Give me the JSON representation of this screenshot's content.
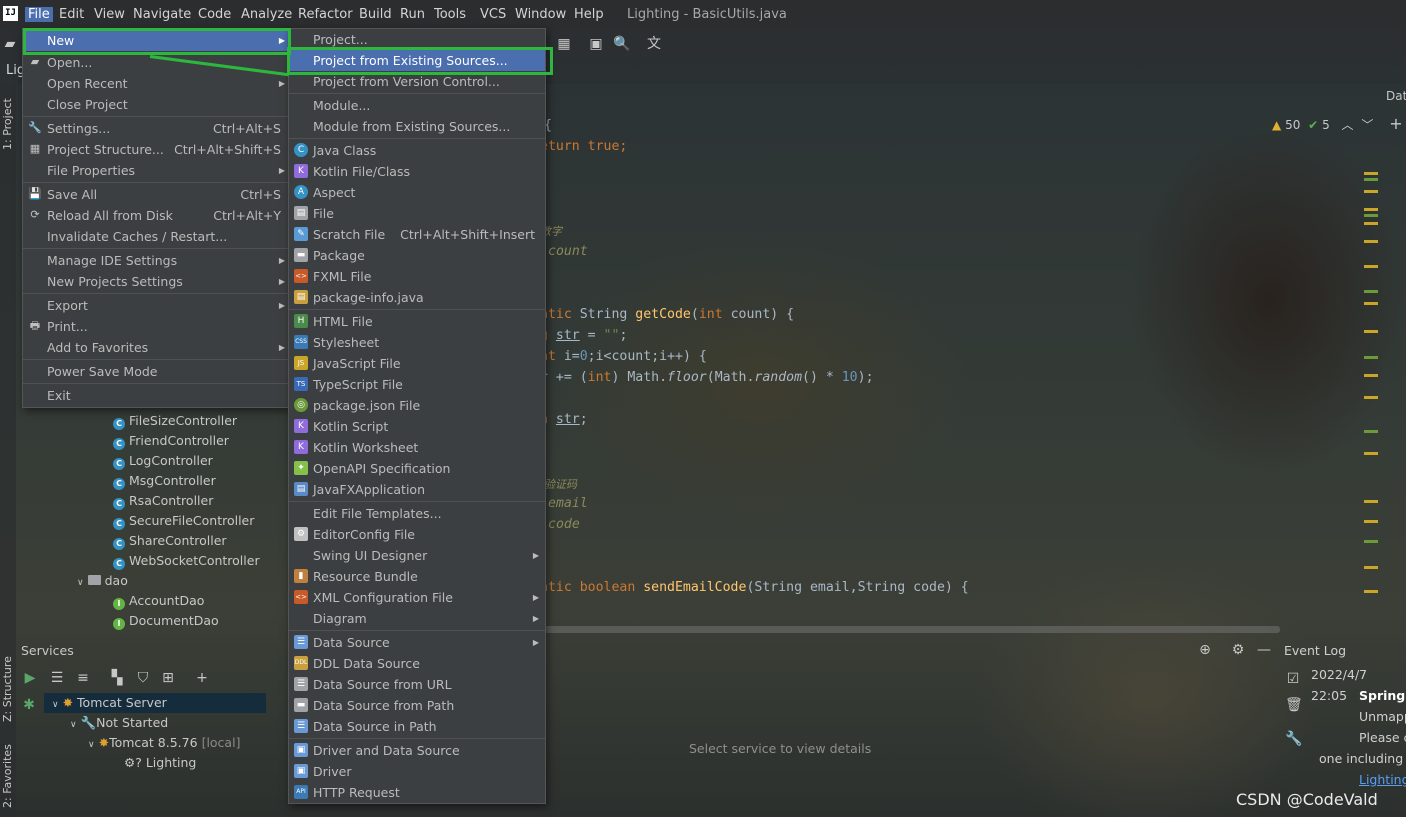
{
  "menubar": {
    "logo": "IJ",
    "items": [
      "File",
      "Edit",
      "View",
      "Navigate",
      "Code",
      "Analyze",
      "Refactor",
      "Build",
      "Run",
      "Tools",
      "VCS",
      "Window",
      "Help"
    ],
    "title": "Lighting - BasicUtils.java"
  },
  "panel": {
    "project_label": "Lig",
    "data_label": "Dat",
    "project_strip": "1: Project",
    "structure_strip": "Z: Structure",
    "favorites_strip": "2: Favorites"
  },
  "inspection": {
    "warnings": "50",
    "ok": "5"
  },
  "editor_lines": [
    {
      "text": "{"
    },
    {
      "text": "eturn true;"
    },
    {
      "text": "数字"
    },
    {
      "text": "count"
    },
    {
      "text": "atic String getCode(int count) {"
    },
    {
      "text": "g str = \"\";"
    },
    {
      "text": "nt i=0;i<count;i++) {"
    },
    {
      "text": "r += (int) Math.floor(Math.random() * 10);"
    },
    {
      "text": "n str;"
    },
    {
      "text": "验证码"
    },
    {
      "text": "email"
    },
    {
      "text": "code"
    },
    {
      "text": "atic boolean sendEmailCode(String email,String code) {"
    }
  ],
  "project_tree": {
    "controllers": [
      "FileSizeController",
      "FriendController",
      "LogController",
      "MsgController",
      "RsaController",
      "SecureFileController",
      "ShareController",
      "WebSocketController"
    ],
    "dao_folder": "dao",
    "dao_items": [
      "AccountDao",
      "DocumentDao"
    ]
  },
  "services": {
    "title": "Services",
    "nodes": [
      "Tomcat Server",
      "Not Started",
      "Tomcat 8.5.76",
      "[local]",
      "Lighting"
    ],
    "empty_text": "Select service to view details"
  },
  "event_log": {
    "title": "Event Log",
    "date": "2022/4/7",
    "time": "22:05",
    "heading": "Spring C",
    "lines": [
      "Unmapp",
      "Please c",
      "one including a",
      "Lighting"
    ]
  },
  "watermark": "CSDN @CodeVald",
  "file_menu": {
    "items": [
      {
        "label": "New",
        "shortcut": "",
        "submenu": true
      },
      {
        "label": "Open...",
        "shortcut": "",
        "submenu": false
      },
      {
        "label": "Open Recent",
        "shortcut": "",
        "submenu": true
      },
      {
        "label": "Close Project",
        "shortcut": "",
        "submenu": false
      },
      {
        "label": "Settings...",
        "shortcut": "Ctrl+Alt+S",
        "submenu": false
      },
      {
        "label": "Project Structure...",
        "shortcut": "Ctrl+Alt+Shift+S",
        "submenu": false
      },
      {
        "label": "File Properties",
        "shortcut": "",
        "submenu": true
      },
      {
        "label": "Save All",
        "shortcut": "Ctrl+S",
        "submenu": false
      },
      {
        "label": "Reload All from Disk",
        "shortcut": "Ctrl+Alt+Y",
        "submenu": false
      },
      {
        "label": "Invalidate Caches / Restart...",
        "shortcut": "",
        "submenu": false
      },
      {
        "label": "Manage IDE Settings",
        "shortcut": "",
        "submenu": true
      },
      {
        "label": "New Projects Settings",
        "shortcut": "",
        "submenu": true
      },
      {
        "label": "Export",
        "shortcut": "",
        "submenu": true
      },
      {
        "label": "Print...",
        "shortcut": "",
        "submenu": false
      },
      {
        "label": "Add to Favorites",
        "shortcut": "",
        "submenu": true
      },
      {
        "label": "Power Save Mode",
        "shortcut": "",
        "submenu": false
      },
      {
        "label": "Exit",
        "shortcut": "",
        "submenu": false
      }
    ]
  },
  "new_menu": {
    "items": [
      {
        "label": "Project...",
        "shortcut": "",
        "submenu": false,
        "icon": "none"
      },
      {
        "label": "Project from Existing Sources...",
        "shortcut": "",
        "submenu": false,
        "icon": "none"
      },
      {
        "label": "Project from Version Control...",
        "shortcut": "",
        "submenu": false,
        "icon": "none"
      },
      {
        "label": "Module...",
        "shortcut": "",
        "submenu": false,
        "icon": "none"
      },
      {
        "label": "Module from Existing Sources...",
        "shortcut": "",
        "submenu": false,
        "icon": "none"
      },
      {
        "label": "Java Class",
        "shortcut": "",
        "submenu": false,
        "icon": "java-class-icon"
      },
      {
        "label": "Kotlin File/Class",
        "shortcut": "",
        "submenu": false,
        "icon": "kotlin-file-icon"
      },
      {
        "label": "Aspect",
        "shortcut": "",
        "submenu": false,
        "icon": "aspect-icon"
      },
      {
        "label": "File",
        "shortcut": "",
        "submenu": false,
        "icon": "file-icon"
      },
      {
        "label": "Scratch File",
        "shortcut": "Ctrl+Alt+Shift+Insert",
        "submenu": false,
        "icon": "scratch-file-icon"
      },
      {
        "label": "Package",
        "shortcut": "",
        "submenu": false,
        "icon": "package-icon"
      },
      {
        "label": "FXML File",
        "shortcut": "",
        "submenu": false,
        "icon": "fxml-file-icon"
      },
      {
        "label": "package-info.java",
        "shortcut": "",
        "submenu": false,
        "icon": "package-info-icon"
      },
      {
        "label": "HTML File",
        "shortcut": "",
        "submenu": false,
        "icon": "html-file-icon"
      },
      {
        "label": "Stylesheet",
        "shortcut": "",
        "submenu": false,
        "icon": "stylesheet-icon"
      },
      {
        "label": "JavaScript File",
        "shortcut": "",
        "submenu": false,
        "icon": "javascript-file-icon"
      },
      {
        "label": "TypeScript File",
        "shortcut": "",
        "submenu": false,
        "icon": "typescript-file-icon"
      },
      {
        "label": "package.json File",
        "shortcut": "",
        "submenu": false,
        "icon": "package-json-icon"
      },
      {
        "label": "Kotlin Script",
        "shortcut": "",
        "submenu": false,
        "icon": "kotlin-script-icon"
      },
      {
        "label": "Kotlin Worksheet",
        "shortcut": "",
        "submenu": false,
        "icon": "kotlin-worksheet-icon"
      },
      {
        "label": "OpenAPI Specification",
        "shortcut": "",
        "submenu": false,
        "icon": "openapi-icon"
      },
      {
        "label": "JavaFXApplication",
        "shortcut": "",
        "submenu": false,
        "icon": "javafx-icon"
      },
      {
        "label": "Edit File Templates...",
        "shortcut": "",
        "submenu": false,
        "icon": "none"
      },
      {
        "label": "EditorConfig File",
        "shortcut": "",
        "submenu": false,
        "icon": "editorconfig-icon"
      },
      {
        "label": "Swing UI Designer",
        "shortcut": "",
        "submenu": true,
        "icon": "none"
      },
      {
        "label": "Resource Bundle",
        "shortcut": "",
        "submenu": false,
        "icon": "resource-bundle-icon"
      },
      {
        "label": "XML Configuration File",
        "shortcut": "",
        "submenu": true,
        "icon": "xml-config-icon"
      },
      {
        "label": "Diagram",
        "shortcut": "",
        "submenu": true,
        "icon": "none"
      },
      {
        "label": "Data Source",
        "shortcut": "",
        "submenu": true,
        "icon": "data-source-icon"
      },
      {
        "label": "DDL Data Source",
        "shortcut": "",
        "submenu": false,
        "icon": "ddl-data-source-icon"
      },
      {
        "label": "Data Source from URL",
        "shortcut": "",
        "submenu": false,
        "icon": "data-source-url-icon"
      },
      {
        "label": "Data Source from Path",
        "shortcut": "",
        "submenu": false,
        "icon": "data-source-path-icon"
      },
      {
        "label": "Data Source in Path",
        "shortcut": "",
        "submenu": false,
        "icon": "data-source-in-path-icon"
      },
      {
        "label": "Driver and Data Source",
        "shortcut": "",
        "submenu": false,
        "icon": "driver-data-source-icon"
      },
      {
        "label": "Driver",
        "shortcut": "",
        "submenu": false,
        "icon": "driver-icon"
      },
      {
        "label": "HTTP Request",
        "shortcut": "",
        "submenu": false,
        "icon": "http-request-icon"
      }
    ]
  },
  "colors": {
    "selection": "#4b6eaf",
    "highlight": "#2db83d",
    "menu_bg": "#3c3f41",
    "keyword": "#cc7832"
  }
}
